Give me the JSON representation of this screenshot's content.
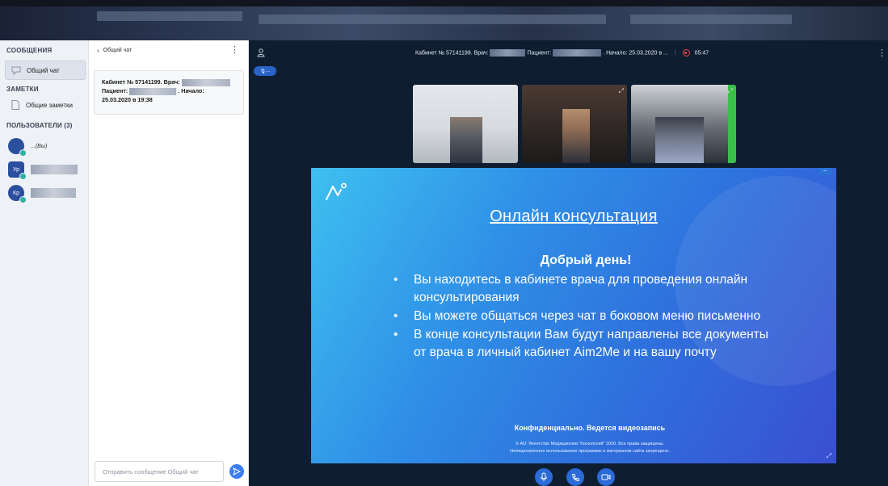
{
  "sidebar": {
    "messages_title": "СООБЩЕНИЯ",
    "general_chat_label": "Общий чат",
    "notes_title": "ЗАМЕТКИ",
    "general_notes_label": "Общие заметки",
    "users_title": "ПОЛЬЗОВАТЕЛИ (3)",
    "users": [
      {
        "initials": "",
        "name": "...(Вы)"
      },
      {
        "initials": "Ур",
        "name": ""
      },
      {
        "initials": "Кр",
        "name": ""
      }
    ]
  },
  "chat": {
    "back_label": "Общий чат",
    "card_line1": "Кабинет № 57141199. Врач:",
    "card_line2_a": "Пациент:",
    "card_line2_b": ". Начало:",
    "card_line3": "25.03.2020 в 19:38",
    "input_placeholder": "Отправить сообщение Общий чат"
  },
  "call": {
    "title_a": "Кабинет № 57141199. Врач:",
    "title_b": "Пациент:",
    "title_c": ". Начало: 25.03.2020 в ...",
    "timer": "05:47",
    "mic_pill": "..."
  },
  "slide": {
    "title": "Онлайн консультация",
    "greeting": "Добрый день!",
    "bullets": [
      "Вы находитесь в кабинете врача для проведения онлайн консультирования",
      "Вы можете общаться через чат в боковом меню письменно",
      "В конце консультации Вам будут направлены все документы от врача в личный кабинет Aim2Me и на вашу почту"
    ],
    "confidential": "Конфиденциально. Ведется видеозапись",
    "copyright_1": "© АО \"Агентство Медицинских Технологий\" 2020. Все права защищены.",
    "copyright_2": "Нелицензионное использование программы и материалов сайта запрещено."
  },
  "colors": {
    "accent": "#2a6bd8",
    "main_bg": "#0f1d30",
    "sidebar_bg": "#eef1f5",
    "record": "#e8434a",
    "online": "#2bb3a3"
  },
  "icons": [
    "chat-bubble-icon",
    "notes-icon",
    "user-icon",
    "more-icon",
    "record-icon",
    "expand-icon",
    "microphone-icon",
    "phone-icon",
    "camera-icon",
    "send-icon",
    "back-icon",
    "logo-icon",
    "fullscreen-icon",
    "minimize-icon"
  ]
}
